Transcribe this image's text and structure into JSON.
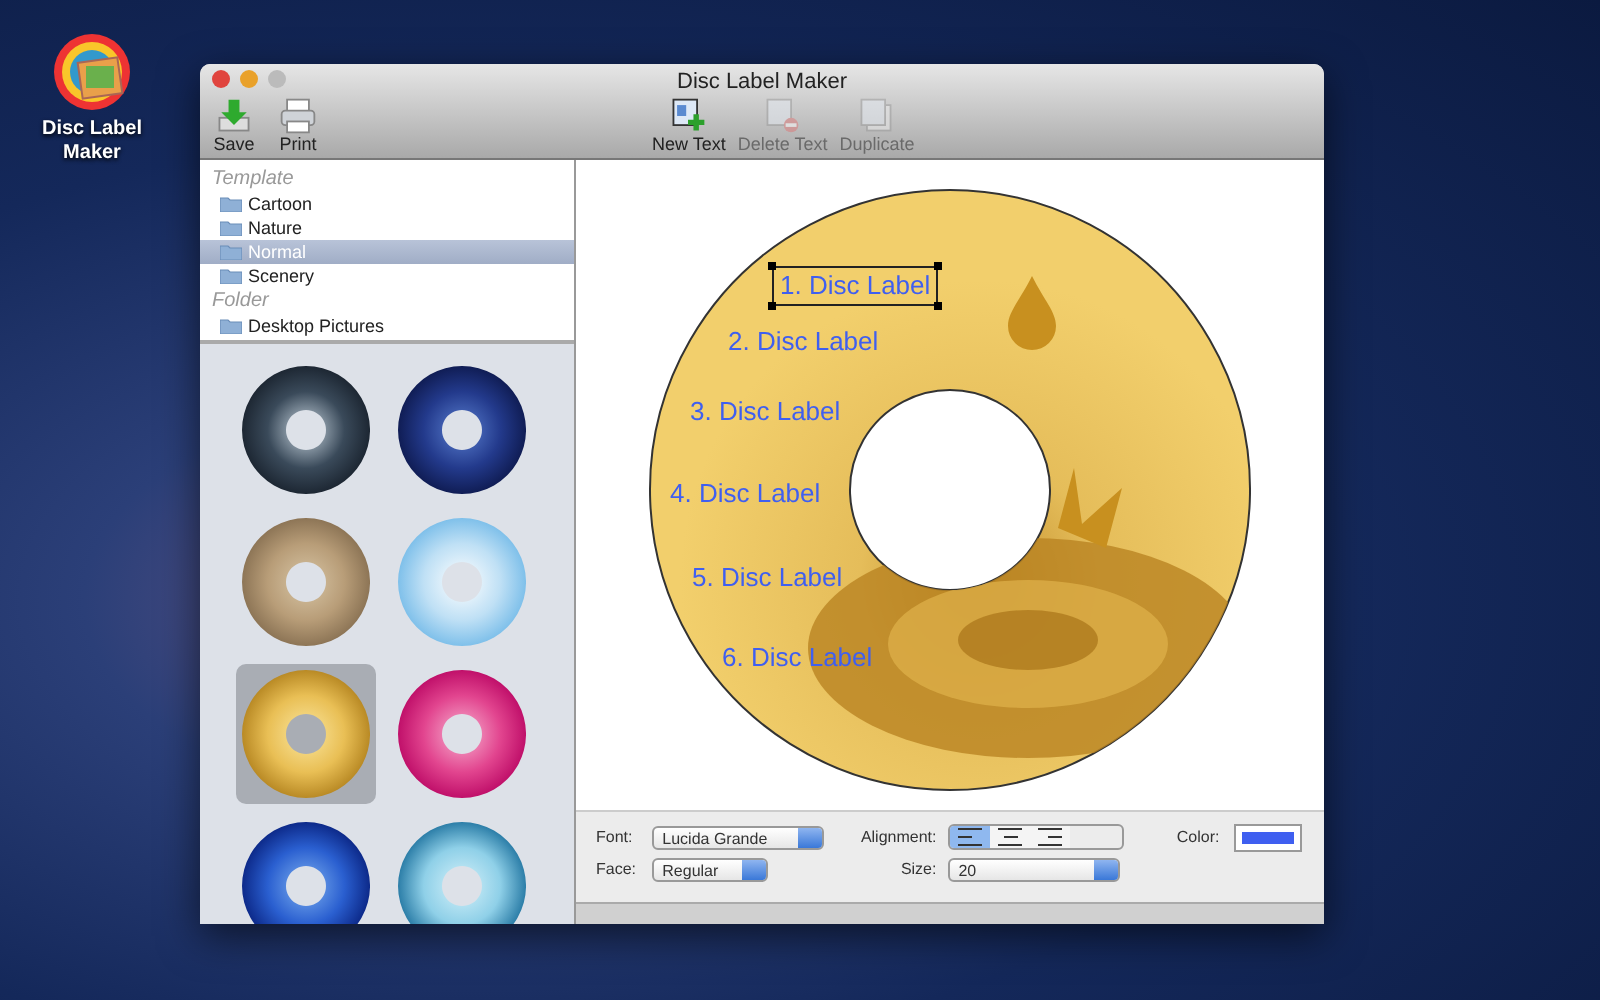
{
  "desktop_icon": {
    "label": "Disc Label Maker"
  },
  "window": {
    "title": "Disc Label Maker"
  },
  "toolbar_left": [
    {
      "kind": "save",
      "label": "Save",
      "disabled": false
    },
    {
      "kind": "print",
      "label": "Print",
      "disabled": false
    }
  ],
  "toolbar_center": [
    {
      "kind": "new",
      "label": "New Text",
      "disabled": false
    },
    {
      "kind": "delete",
      "label": "Delete Text",
      "disabled": true
    },
    {
      "kind": "duplicate",
      "label": "Duplicate",
      "disabled": true
    }
  ],
  "sidebar": [
    {
      "heading": "Template",
      "items": [
        {
          "label": "Cartoon",
          "selected": false
        },
        {
          "label": "Nature",
          "selected": false
        },
        {
          "label": "Normal",
          "selected": true
        },
        {
          "label": "Scenery",
          "selected": false
        }
      ]
    },
    {
      "heading": "Folder",
      "items": [
        {
          "label": "Desktop Pictures",
          "selected": false
        }
      ]
    }
  ],
  "thumbnails": [
    {
      "kind": "night",
      "selected": false
    },
    {
      "kind": "sky",
      "selected": false
    },
    {
      "kind": "wood",
      "selected": false
    },
    {
      "kind": "cloud",
      "selected": false
    },
    {
      "kind": "gold",
      "selected": true
    },
    {
      "kind": "pink",
      "selected": false
    },
    {
      "kind": "blue",
      "selected": false
    },
    {
      "kind": "wave",
      "selected": false
    }
  ],
  "canvas": {
    "labels": [
      {
        "text": "1. Disc Label",
        "selected": true
      },
      {
        "text": "2. Disc Label",
        "selected": false
      },
      {
        "text": "3. Disc Label",
        "selected": false
      },
      {
        "text": "4. Disc Label",
        "selected": false
      },
      {
        "text": "5. Disc Label",
        "selected": false
      },
      {
        "text": "6. Disc Label",
        "selected": false
      }
    ]
  },
  "controls": {
    "font": {
      "label": "Font:",
      "value": "Lucida Grande"
    },
    "face": {
      "label": "Face:",
      "value": "Regular"
    },
    "alignment": {
      "label": "Alignment:",
      "options": [
        {
          "kind": "left",
          "selected": true
        },
        {
          "kind": "center",
          "selected": false
        },
        {
          "kind": "right",
          "selected": false
        }
      ]
    },
    "size": {
      "label": "Size:",
      "value": "20"
    },
    "color": {
      "label": "Color:",
      "color": "#3f5ff0"
    }
  }
}
